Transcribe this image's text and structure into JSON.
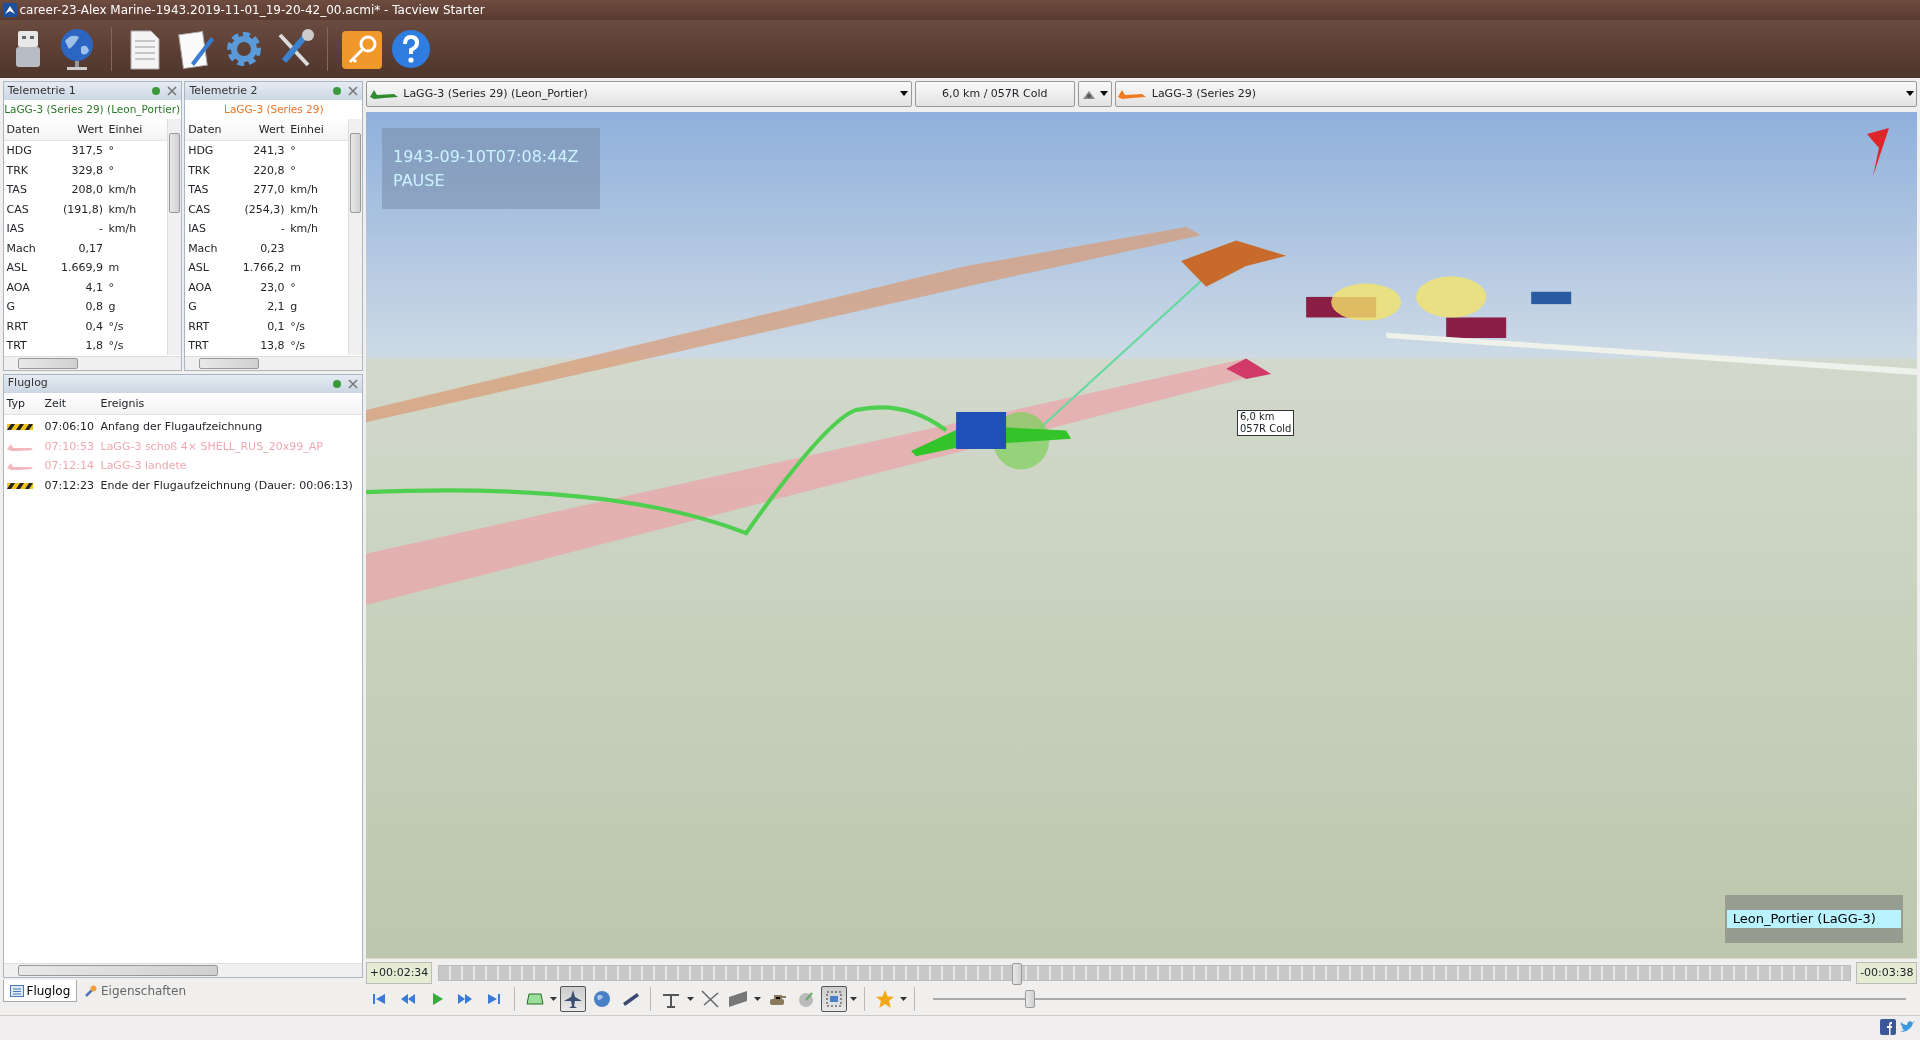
{
  "window": {
    "title": "career-23-Alex Marine-1943.2019-11-01_19-20-42_00.acmi* - Tacview Starter"
  },
  "telemetry_panels": [
    {
      "title": "Telemetrie 1",
      "aircraft": "LaGG-3 (Series 29) (Leon_Portier)",
      "color": "#2a7a2a",
      "columns": [
        "Daten",
        "Wert",
        "Einhei"
      ],
      "rows": [
        {
          "name": "HDG",
          "value": "317,5",
          "unit": "°"
        },
        {
          "name": "TRK",
          "value": "329,8",
          "unit": "°"
        },
        {
          "name": "TAS",
          "value": "208,0",
          "unit": "km/h"
        },
        {
          "name": "CAS",
          "value": "(191,8)",
          "unit": "km/h"
        },
        {
          "name": "IAS",
          "value": "-",
          "unit": "km/h"
        },
        {
          "name": "Mach",
          "value": "0,17"
        },
        {
          "name": "ASL",
          "value": "1.669,9",
          "unit": "m"
        },
        {
          "name": "AOA",
          "value": "4,1",
          "unit": "°"
        },
        {
          "name": "G",
          "value": "0,8",
          "unit": "g"
        },
        {
          "name": "RRT",
          "value": "0,4",
          "unit": "°/s"
        },
        {
          "name": "TRT",
          "value": "1,8",
          "unit": "°/s"
        }
      ]
    },
    {
      "title": "Telemetrie 2",
      "aircraft": "LaGG-3 (Series 29)",
      "color": "#e8742a",
      "columns": [
        "Daten",
        "Wert",
        "Einhei"
      ],
      "rows": [
        {
          "name": "HDG",
          "value": "241,3",
          "unit": "°"
        },
        {
          "name": "TRK",
          "value": "220,8",
          "unit": "°"
        },
        {
          "name": "TAS",
          "value": "277,0",
          "unit": "km/h"
        },
        {
          "name": "CAS",
          "value": "(254,3)",
          "unit": "km/h"
        },
        {
          "name": "IAS",
          "value": "-",
          "unit": "km/h"
        },
        {
          "name": "Mach",
          "value": "0,23"
        },
        {
          "name": "ASL",
          "value": "1.766,2",
          "unit": "m"
        },
        {
          "name": "AOA",
          "value": "23,0",
          "unit": "°"
        },
        {
          "name": "G",
          "value": "2,1",
          "unit": "g"
        },
        {
          "name": "RRT",
          "value": "0,1",
          "unit": "°/s"
        },
        {
          "name": "TRT",
          "value": "13,8",
          "unit": "°/s"
        }
      ]
    }
  ],
  "flight_log": {
    "title": "Fluglog",
    "columns": [
      "Typ",
      "Zeit",
      "Ereignis"
    ],
    "events": [
      {
        "kind": "recording",
        "time": "07:06:10",
        "text": "Anfang der Flugaufzeichnung"
      },
      {
        "kind": "aircraft",
        "time": "07:10:53",
        "text": "LaGG-3 schoß 4× SHELL_RUS_20x99_AP"
      },
      {
        "kind": "aircraft",
        "time": "07:12:14",
        "text": "LaGG-3 landete"
      },
      {
        "kind": "recording",
        "time": "07:12:23",
        "text": "Ende der Flugaufzeichnung (Dauer: 00:06:13)"
      }
    ]
  },
  "left_tabs": [
    {
      "label": "Fluglog",
      "selected": true
    },
    {
      "label": "Eigenschaften",
      "selected": false
    }
  ],
  "selectors": {
    "primary": {
      "label": "LaGG-3 (Series 29) (Leon_Portier)",
      "color": "#2e8b2e"
    },
    "distance": "6,0 km / 057R Cold",
    "secondary": {
      "label": "LaGG-3 (Series 29)",
      "color": "#f07a20"
    }
  },
  "viewport": {
    "time": "1943-09-10T07:08:44Z",
    "status": "PAUSE",
    "range_label": [
      "6,0 km",
      "057R Cold"
    ],
    "name_label": "Leon_Portier (LaGG-3)"
  },
  "timeline": {
    "elapsed": "+00:02:34",
    "remaining": "-00:03:38",
    "level": 0.41
  },
  "camera_modes": [
    {
      "selected": false
    },
    {
      "selected": true
    },
    {
      "selected": false
    },
    {
      "selected": false
    }
  ],
  "overlay_toggle": {
    "selected": true
  },
  "speed": {
    "level": 0.1
  }
}
